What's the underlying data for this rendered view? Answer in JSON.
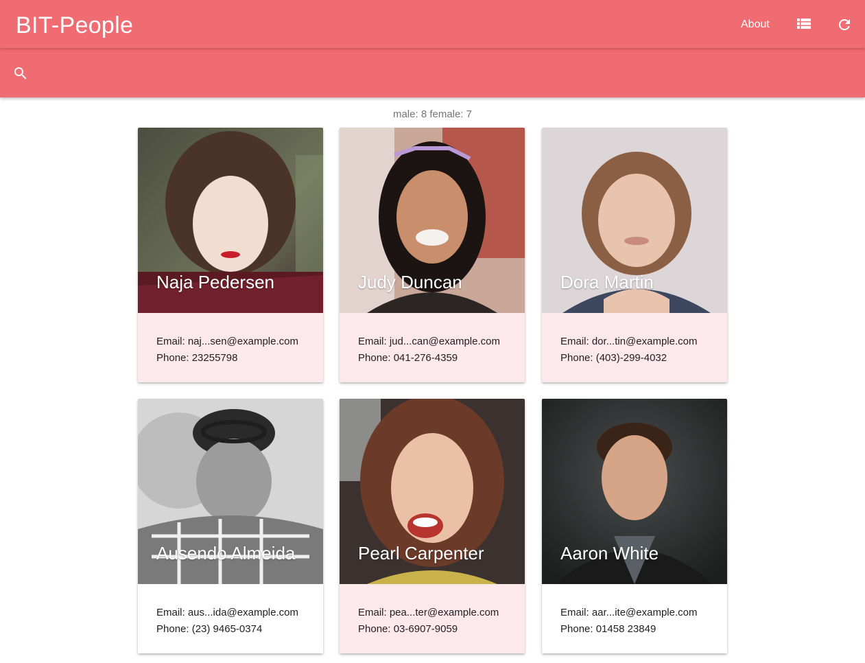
{
  "app": {
    "title": "BIT-People",
    "nav": {
      "about_label": "About",
      "list_view_icon": "view-list-icon",
      "refresh_icon": "refresh-icon"
    },
    "accent_color": "#ef6c72"
  },
  "search": {
    "icon": "search-icon",
    "value": "",
    "placeholder": ""
  },
  "stats": {
    "text": "male: 8 female: 7"
  },
  "cards": [
    {
      "name": "Naja Pedersen",
      "gender": "female",
      "email": "Email: naj...sen@example.com",
      "phone": "Phone: 23255798"
    },
    {
      "name": "Judy Duncan",
      "gender": "female",
      "email": "Email: jud...can@example.com",
      "phone": "Phone: 041-276-4359"
    },
    {
      "name": "Dora Martin",
      "gender": "female",
      "email": "Email: dor...tin@example.com",
      "phone": "Phone: (403)-299-4032"
    },
    {
      "name": "Ausendo Almeida",
      "gender": "male",
      "email": "Email: aus...ida@example.com",
      "phone": "Phone: (23) 9465-0374"
    },
    {
      "name": "Pearl Carpenter",
      "gender": "female",
      "email": "Email: pea...ter@example.com",
      "phone": "Phone: 03-6907-9059"
    },
    {
      "name": "Aaron White",
      "gender": "male",
      "email": "Email: aar...ite@example.com",
      "phone": "Phone: 01458 23849"
    }
  ]
}
